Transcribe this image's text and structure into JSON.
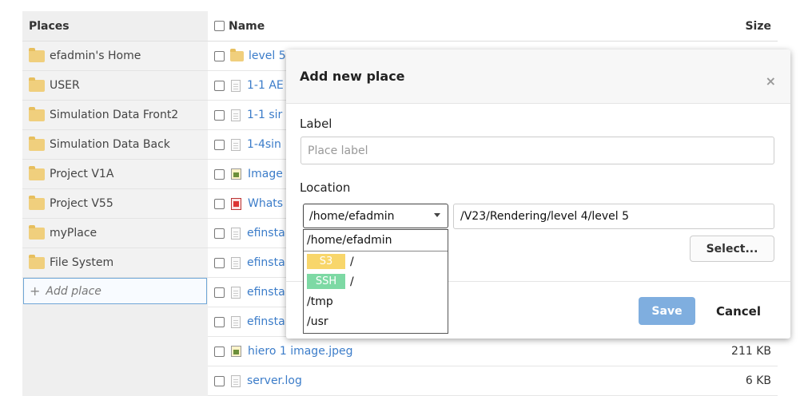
{
  "places": {
    "header": "Places",
    "items": [
      {
        "label": "efadmin's Home"
      },
      {
        "label": "USER"
      },
      {
        "label": "Simulation Data Front2"
      },
      {
        "label": "Simulation Data Back"
      },
      {
        "label": "Project V1A"
      },
      {
        "label": "Project V55"
      },
      {
        "label": "myPlace"
      },
      {
        "label": "File System"
      }
    ],
    "add_label": "Add place"
  },
  "files": {
    "header_name": "Name",
    "header_size": "Size",
    "rows": [
      {
        "name": "level 5",
        "type": "folder",
        "size": ""
      },
      {
        "name": "1-1 AE",
        "type": "doc",
        "size": ""
      },
      {
        "name": "1-1 sir",
        "type": "doc",
        "size": ""
      },
      {
        "name": "1-4sin",
        "type": "doc",
        "size": ""
      },
      {
        "name": "Image",
        "type": "image",
        "size": ""
      },
      {
        "name": "Whats",
        "type": "pdf",
        "size": ""
      },
      {
        "name": "efinsta",
        "type": "doc",
        "size": ""
      },
      {
        "name": "efinsta",
        "type": "doc",
        "size": ""
      },
      {
        "name": "efinsta",
        "type": "doc",
        "size": ""
      },
      {
        "name": "efinsta",
        "type": "doc",
        "size": ""
      },
      {
        "name": "hiero 1 image.jpeg",
        "type": "image",
        "size": "211 KB"
      },
      {
        "name": "server.log",
        "type": "doc",
        "size": "6 KB"
      }
    ]
  },
  "modal": {
    "title": "Add new place",
    "close": "×",
    "label_field": "Label",
    "label_placeholder": "Place label",
    "location_field": "Location",
    "location_selected": "/home/efadmin",
    "path_value": "/V23/Rendering/level 4/level 5",
    "select_button": "Select...",
    "save_button": "Save",
    "cancel_button": "Cancel"
  },
  "dropdown": {
    "options": [
      {
        "badge": "",
        "text": "/home/efadmin"
      },
      {
        "badge": "S3",
        "text": "/"
      },
      {
        "badge": "SSH",
        "text": "/"
      },
      {
        "badge": "",
        "text": "/tmp"
      },
      {
        "badge": "",
        "text": "/usr"
      }
    ]
  },
  "colors": {
    "link": "#3b7cc9",
    "save": "#7faedf",
    "s3_badge": "#f8d66b",
    "ssh_badge": "#7dd9a4",
    "folder": "#f0cf7d"
  }
}
